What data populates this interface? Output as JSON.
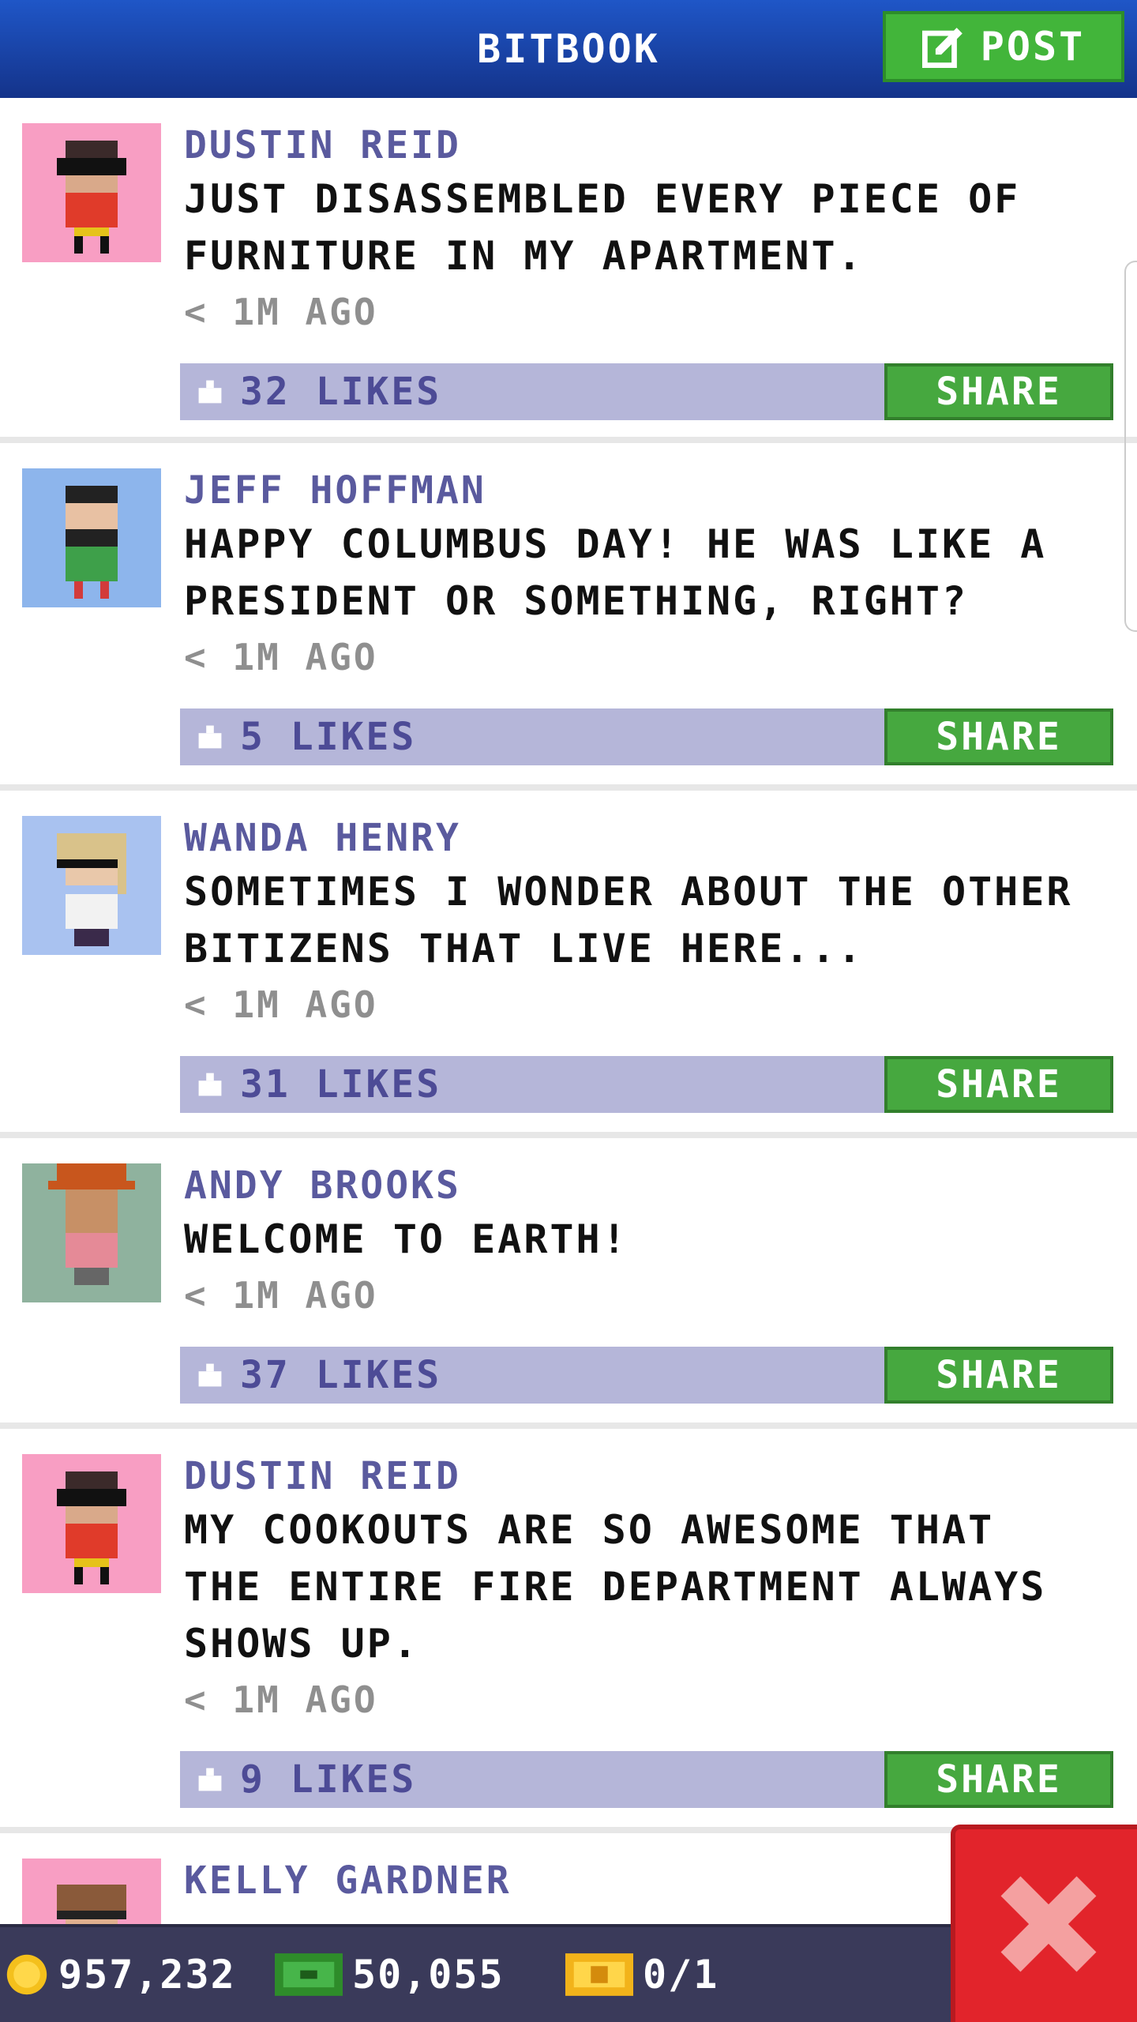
{
  "header": {
    "title": "BITBOOK",
    "post_label": "POST"
  },
  "posts": [
    {
      "author": "DUSTIN REID",
      "message": [
        "JUST DISASSEMBLED EVERY PIECE OF",
        "FURNITURE IN MY APARTMENT."
      ],
      "time": "< 1M AGO",
      "likes": "32 LIKES",
      "share": "SHARE",
      "avatar_bg": "#f89ec3"
    },
    {
      "author": "JEFF HOFFMAN",
      "message": [
        "HAPPY COLUMBUS DAY! HE WAS LIKE A",
        "PRESIDENT OR SOMETHING, RIGHT?"
      ],
      "time": "< 1M AGO",
      "likes": "5 LIKES",
      "share": "SHARE",
      "avatar_bg": "#8db5ec"
    },
    {
      "author": "WANDA HENRY",
      "message": [
        "SOMETIMES I WONDER ABOUT THE OTHER",
        "BITIZENS THAT LIVE HERE..."
      ],
      "time": "< 1M AGO",
      "likes": "31 LIKES",
      "share": "SHARE",
      "avatar_bg": "#a9c2f0"
    },
    {
      "author": "ANDY BROOKS",
      "message": [
        "WELCOME TO EARTH!"
      ],
      "time": "< 1M AGO",
      "likes": "37 LIKES",
      "share": "SHARE",
      "avatar_bg": "#8fb29e"
    },
    {
      "author": "DUSTIN REID",
      "message": [
        "MY COOKOUTS ARE SO AWESOME THAT",
        "THE ENTIRE FIRE DEPARTMENT ALWAYS",
        "SHOWS UP."
      ],
      "time": "< 1M AGO",
      "likes": "9 LIKES",
      "share": "SHARE",
      "avatar_bg": "#f89ec3"
    },
    {
      "author": "KELLY GARDNER",
      "message": [],
      "time": "",
      "likes": "",
      "share": "",
      "avatar_bg": "#f89ec3"
    }
  ],
  "status_bar": {
    "coins": "957,232",
    "bux": "50,055",
    "tickets": "0/1"
  },
  "colors": {
    "header": "#1a47b0",
    "accent_green": "#46a83f",
    "likes_bar": "#b5b6d9",
    "close_red": "#e2242b"
  }
}
